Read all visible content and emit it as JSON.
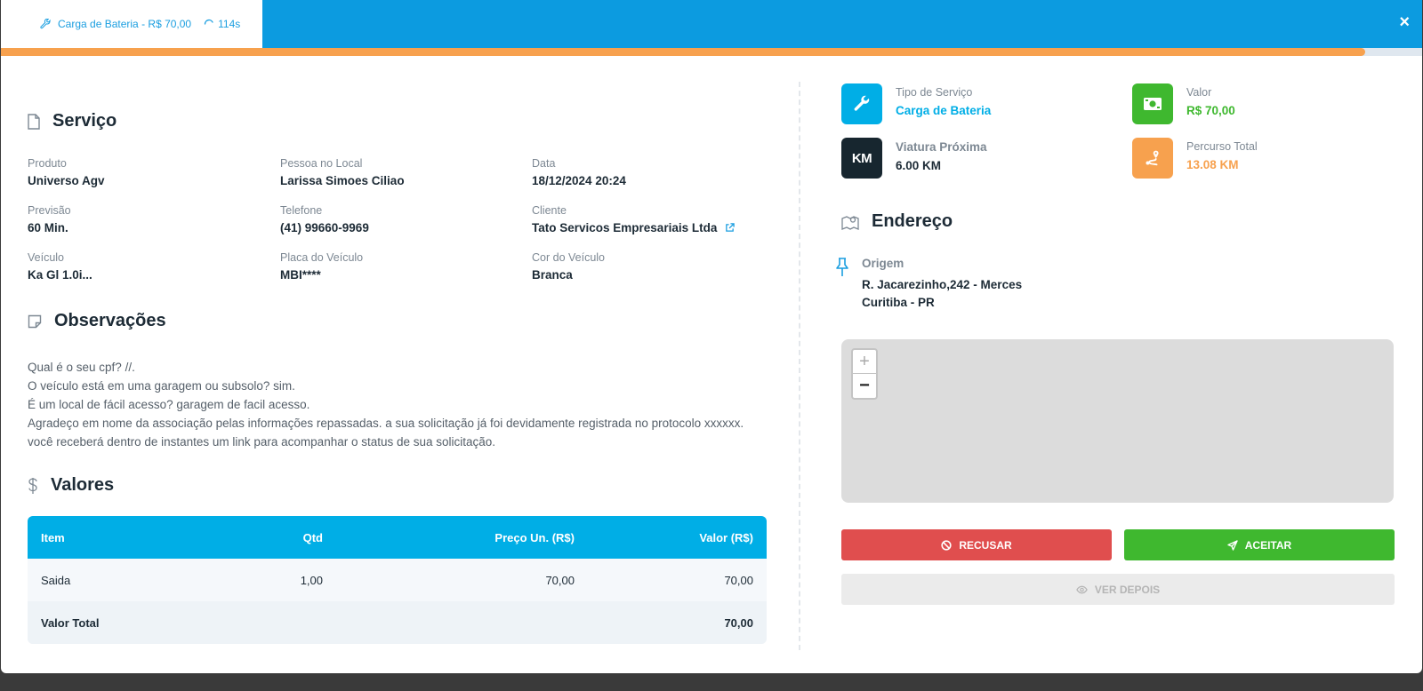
{
  "header": {
    "tab_service": "Carga de Bateria",
    "tab_price": " - R$ 70,00",
    "timer": "114s",
    "close_label": "×",
    "progress_percent": 96,
    "bg_color": "#0c9be0",
    "progress_color": "#f7a14e"
  },
  "servico": {
    "title": "Serviço",
    "fields": {
      "produto": {
        "label": "Produto",
        "value": "Universo Agv"
      },
      "pessoa": {
        "label": "Pessoa no Local",
        "value": "Larissa Simoes Ciliao"
      },
      "data": {
        "label": "Data",
        "value": "18/12/2024 20:24"
      },
      "previsao": {
        "label": "Previsão",
        "value": "60 Min."
      },
      "telefone": {
        "label": "Telefone",
        "value": "(41) 99660-9969"
      },
      "cliente": {
        "label": "Cliente",
        "value": "Tato Servicos Empresariais Ltda"
      },
      "veiculo": {
        "label": "Veículo",
        "value": "Ka Gl 1.0i..."
      },
      "placa": {
        "label": "Placa do Veículo",
        "value": "MBI****"
      },
      "cor": {
        "label": "Cor do Veículo",
        "value": "Branca"
      }
    }
  },
  "observacoes": {
    "title": "Observações",
    "lines": [
      "Qual é o seu cpf? //.",
      "O veículo está em uma garagem ou subsolo? sim.",
      "É um local de fácil acesso? garagem de facil acesso.",
      "Agradeço em nome da associação pelas informações repassadas. a sua solicitação já foi devidamente registrada no protocolo xxxxxx.",
      "você receberá dentro de instantes um link para acompanhar o status de sua solicitação."
    ]
  },
  "valores": {
    "title": "Valores",
    "columns": [
      "Item",
      "Qtd",
      "Preço Un. (R$)",
      "Valor (R$)"
    ],
    "rows": [
      {
        "item": "Saida",
        "qtd": "1,00",
        "preco": "70,00",
        "valor": "70,00"
      }
    ],
    "total_label": "Valor Total",
    "total_value": "70,00"
  },
  "summary": {
    "tipo": {
      "label": "Tipo de Serviço",
      "value": "Carga de Bateria",
      "icon": "wrench-icon",
      "color": "#00aee6"
    },
    "valor": {
      "label": "Valor",
      "value": "R$ 70,00",
      "icon": "money-icon",
      "color": "#3fb82f"
    },
    "viatura": {
      "label": "Viatura Próxima",
      "value": "6.00 KM",
      "icon_text": "KM",
      "icon": "km-icon",
      "color": "#17262f"
    },
    "percurso": {
      "label": "Percurso Total",
      "value": "13.08 KM",
      "icon": "route-icon",
      "color": "#f7a14e"
    }
  },
  "endereco": {
    "title": "Endereço",
    "origem_label": "Origem",
    "origem_line1": "R. Jacarezinho,242 - Merces",
    "origem_line2": "Curitiba - PR"
  },
  "map": {
    "zoom_in": "+",
    "zoom_out": "−"
  },
  "actions": {
    "recusar": "RECUSAR",
    "aceitar": "ACEITAR",
    "ver_depois": "VER DEPOIS"
  }
}
